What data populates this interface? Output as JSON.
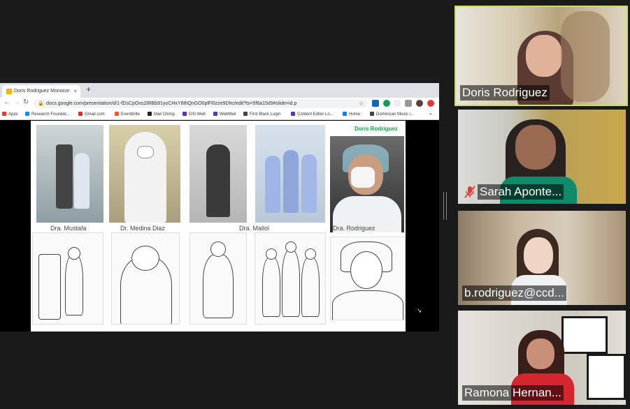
{
  "browser": {
    "tab_title": "Doris Rodriguez Monocorde - ",
    "tab_close": "×",
    "new_tab": "+",
    "url": "docs.google.com/presentation/d/1-fDsCpOxs28lIBb91yoCHxY6thQnGO0plFl0zze9Dhc/edit?ts=5f6a15d9#slide=id.p",
    "bookmarks": [
      {
        "label": "Apps",
        "color": "#e53935"
      },
      {
        "label": "Research Foundat...",
        "color": "#1e88e5"
      },
      {
        "label": "Gmail.com",
        "color": "#d93025"
      },
      {
        "label": "Eventbrite",
        "color": "#f05537"
      },
      {
        "label": "Mail Chimp",
        "color": "#222222"
      },
      {
        "label": "DSI Web",
        "color": "#5e35b1"
      },
      {
        "label": "WebMail",
        "color": "#5e35b1"
      },
      {
        "label": "First Black Login",
        "color": "#444444"
      },
      {
        "label": "Content Editor Lo...",
        "color": "#5e35b1"
      },
      {
        "label": "Home",
        "color": "#1877f2"
      },
      {
        "label": "Dominican Music i...",
        "color": "#444444"
      }
    ],
    "more": "»"
  },
  "slide": {
    "presenter_name": "Doris Rodriguez",
    "captions": [
      "Dra. Mustafa",
      "Dr. Medina Diaz",
      "Dra. Mallol",
      "Dra. Rodriguez"
    ]
  },
  "participants": [
    {
      "name": "Doris Rodriguez",
      "muted": false,
      "active_speaker": true
    },
    {
      "name": "Sarah Aponte...",
      "muted": true,
      "active_speaker": false
    },
    {
      "name": "b.rodriguez@ccd...",
      "muted": false,
      "active_speaker": false
    },
    {
      "name": "Ramona Hernan...",
      "muted": false,
      "active_speaker": false
    }
  ],
  "colors": {
    "active_speaker_border": "#c9e05a",
    "presenter_name": "#16a34a",
    "mute_icon": "#e53935"
  }
}
